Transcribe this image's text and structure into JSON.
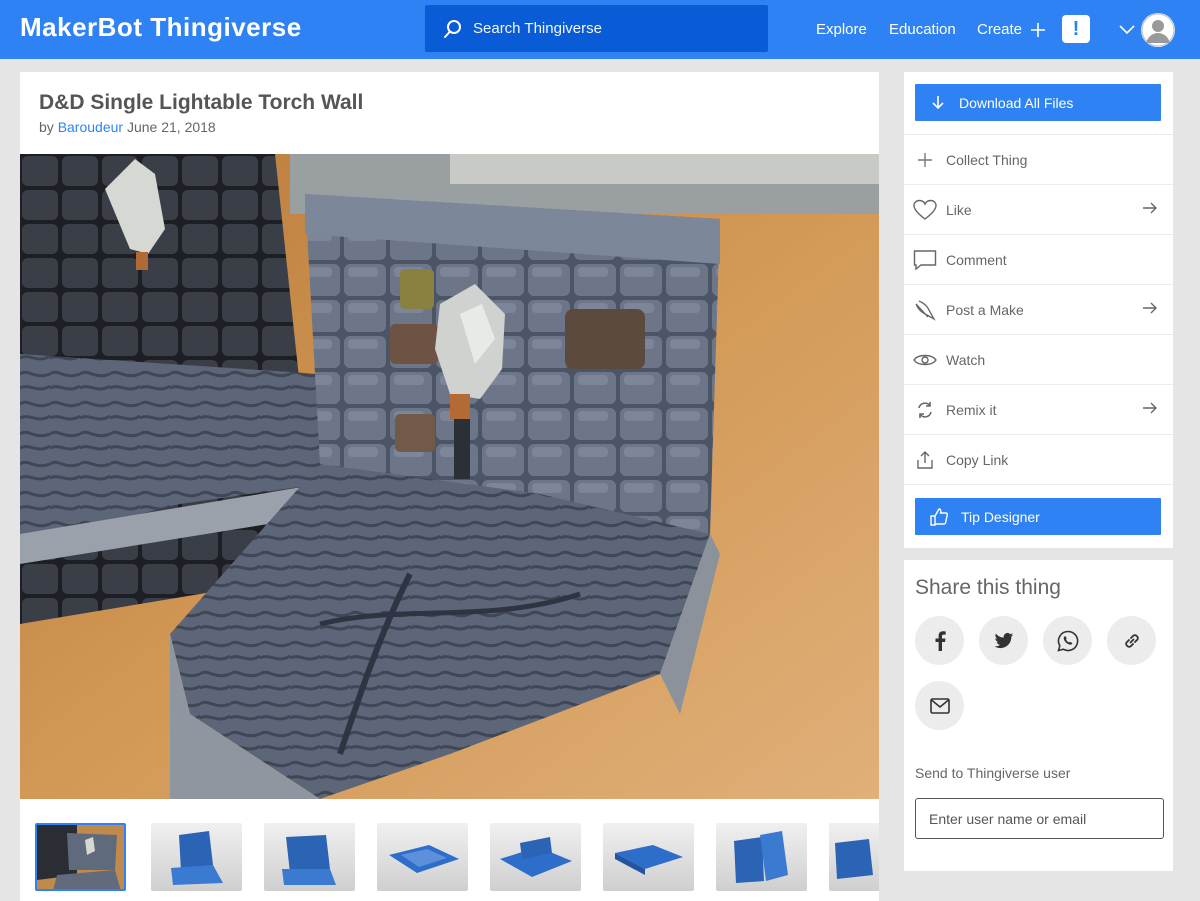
{
  "topbar": {
    "logo_prefix": "MakerBot",
    "logo_name": "Thingiverse",
    "search_placeholder": "Search Thingiverse",
    "nav": {
      "explore": "Explore",
      "education": "Education",
      "create": "Create"
    },
    "alert_label": "!",
    "colors": {
      "bar": "#2f82f4",
      "search": "#0a5bd6"
    }
  },
  "thing": {
    "title": "D&D Single Lightable Torch Wall",
    "by_label": "by",
    "author": "Baroudeur",
    "date": "June 21, 2018",
    "thumbnail_count": 8
  },
  "actions": {
    "download": "Download All Files",
    "items": [
      {
        "label": "Collect Thing",
        "icon": "plus-icon",
        "arrow": false
      },
      {
        "label": "Like",
        "icon": "heart-icon",
        "arrow": true
      },
      {
        "label": "Comment",
        "icon": "comment-icon",
        "arrow": false
      },
      {
        "label": "Post a Make",
        "icon": "make-icon",
        "arrow": true
      },
      {
        "label": "Watch",
        "icon": "eye-icon",
        "arrow": false
      },
      {
        "label": "Remix it",
        "icon": "remix-icon",
        "arrow": true
      },
      {
        "label": "Copy Link",
        "icon": "share-icon",
        "arrow": false
      }
    ],
    "tip": "Tip Designer"
  },
  "share": {
    "title": "Share this thing",
    "networks": [
      "facebook-icon",
      "twitter-icon",
      "whatsapp-icon",
      "link-icon",
      "email-icon"
    ],
    "send_label": "Send to Thingiverse user",
    "send_placeholder": "Enter user name or email"
  }
}
